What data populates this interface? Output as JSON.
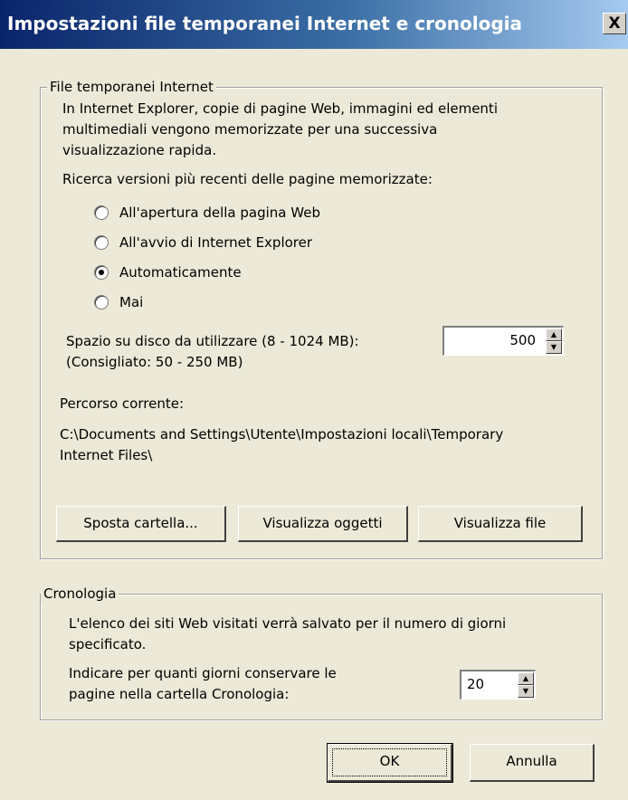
{
  "window": {
    "title": "Impostazioni file temporanei Internet e cronologia",
    "close_label": "X"
  },
  "temp_files": {
    "legend": "File temporanei Internet",
    "description": [
      "In Internet Explorer, copie di pagine Web, immagini ed elementi",
      "multimediali vengono memorizzate per una successiva",
      "visualizzazione rapida."
    ],
    "check_label": "Ricerca versioni più recenti delle pagine memorizzate:",
    "radio_options": [
      {
        "label": "All'apertura della pagina Web",
        "checked": false
      },
      {
        "label": "All'avvio di Internet Explorer",
        "checked": false
      },
      {
        "label": "Automaticamente",
        "checked": true
      },
      {
        "label": "Mai",
        "checked": false
      }
    ],
    "disk_space_label": "Spazio su disco da utilizzare (8 - 1024 MB):",
    "disk_space_hint": "(Consigliato: 50 - 250 MB)",
    "disk_space_value": "500",
    "current_path_label": "Percorso corrente:",
    "current_path_lines": [
      "C:\\Documents and Settings\\Utente\\Impostazioni locali\\Temporary",
      "Internet Files\\"
    ],
    "buttons": {
      "move_folder": "Sposta cartella...",
      "view_objects": "Visualizza oggetti",
      "view_files": "Visualizza file"
    }
  },
  "history": {
    "legend": "Cronologia",
    "description": [
      "L'elenco dei siti Web visitati verrà salvato per il numero di giorni",
      "specificato."
    ],
    "days_label": [
      "Indicare per quanti giorni conservare le",
      "pagine nella cartella Cronologia:"
    ],
    "days_value": "20"
  },
  "footer": {
    "ok": "OK",
    "cancel": "Annulla"
  },
  "icons": {
    "spin_up": "▲",
    "spin_down": "▼"
  }
}
